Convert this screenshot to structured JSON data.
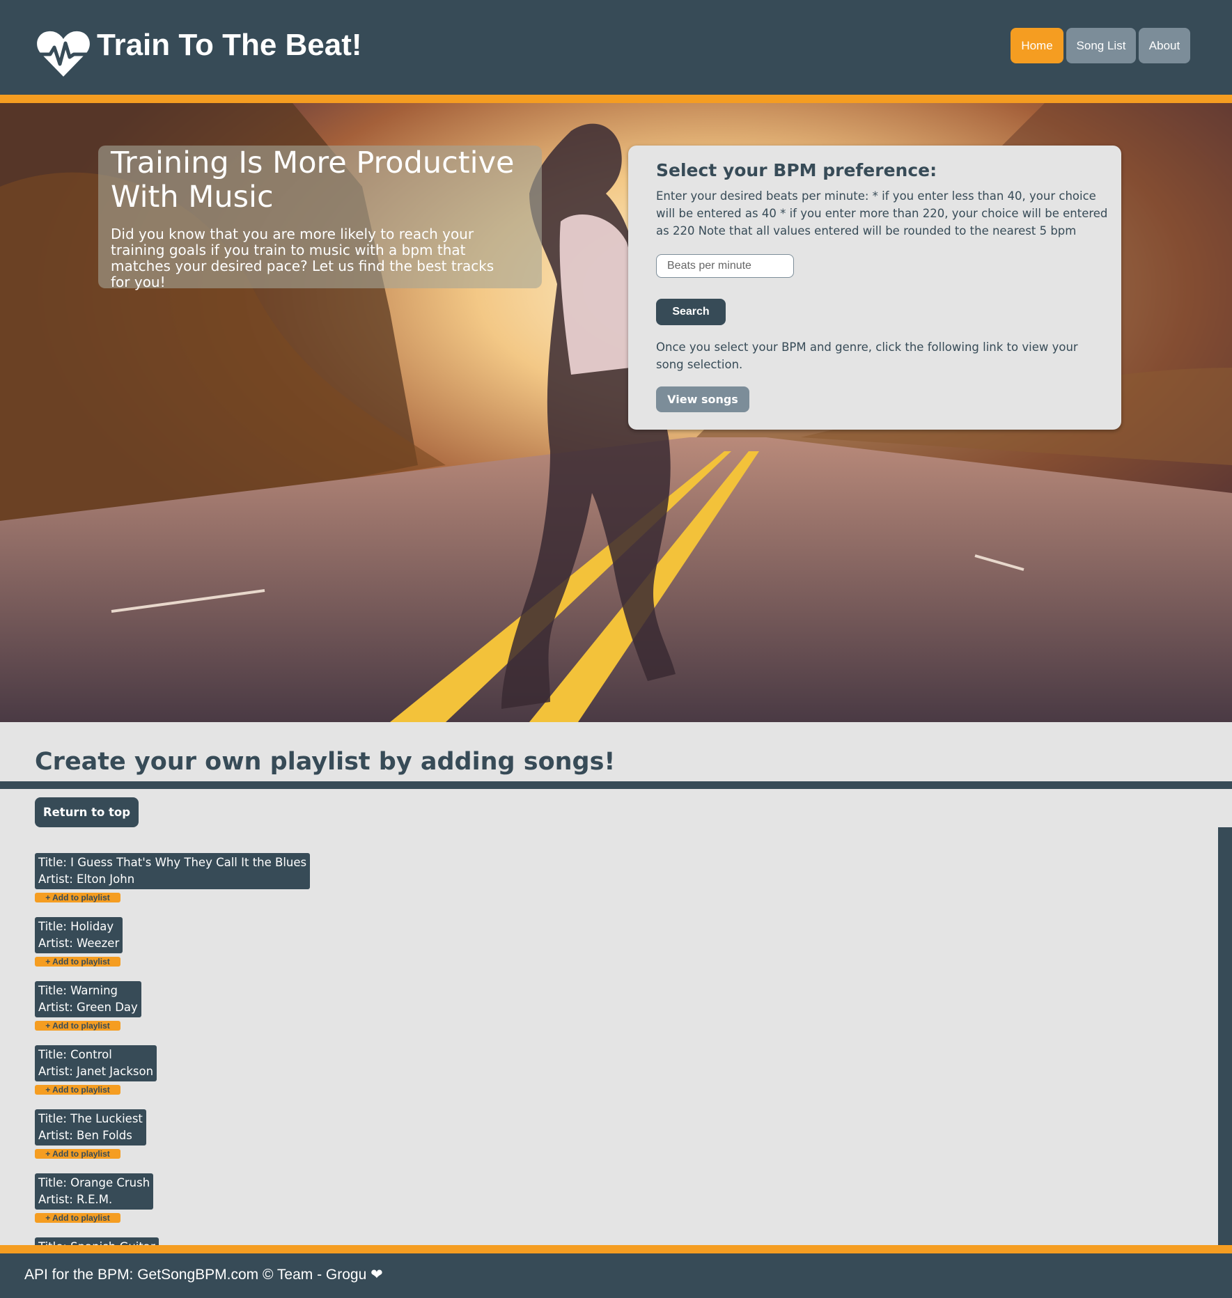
{
  "header": {
    "site_title": "Train To The Beat!",
    "logo_icon": "heartbeat-icon",
    "nav": [
      {
        "label": "Home",
        "active": true
      },
      {
        "label": "Song List",
        "active": false
      },
      {
        "label": "About",
        "active": false
      }
    ]
  },
  "hero": {
    "title": "Training Is More Productive With Music",
    "text": "Did you know that you are more likely to reach your training goals if you train to music with a bpm that matches your desired pace? Let us find the best tracks for you!"
  },
  "bpm_form": {
    "title": "Select your BPM preference:",
    "instructions": "Enter your desired beats per minute: * if you enter less than 40, your choice will be entered as 40 * if you enter more than 220, your choice will be entered as 220 Note that all values entered will be rounded to the nearest 5 bpm",
    "input_placeholder": "Beats per minute",
    "search_label": "Search",
    "note": "Once you select your BPM and genre, click the following link to view your song selection.",
    "view_songs_label": "View songs"
  },
  "playlist": {
    "heading": "Create your own playlist by adding songs!",
    "return_label": "Return to top",
    "add_label": "+ Add to playlist",
    "songs": [
      {
        "title": "Title: I Guess That's Why They Call It the Blues",
        "artist": "Artist: Elton John"
      },
      {
        "title": "Title: Holiday",
        "artist": "Artist: Weezer"
      },
      {
        "title": "Title: Warning",
        "artist": "Artist: Green Day"
      },
      {
        "title": "Title: Control",
        "artist": "Artist: Janet Jackson"
      },
      {
        "title": "Title: The Luckiest",
        "artist": "Artist: Ben Folds"
      },
      {
        "title": "Title: Orange Crush",
        "artist": "Artist: R.E.M."
      },
      {
        "title": "Title: Spanish Guitar",
        "artist": ""
      }
    ]
  },
  "footer": {
    "text": "API for the BPM: GetSongBPM.com © Team - Grogu ❤"
  },
  "colors": {
    "primary": "#374b57",
    "accent": "#f59d21",
    "muted_button": "#7c8d99",
    "background": "#e4e4e4"
  }
}
